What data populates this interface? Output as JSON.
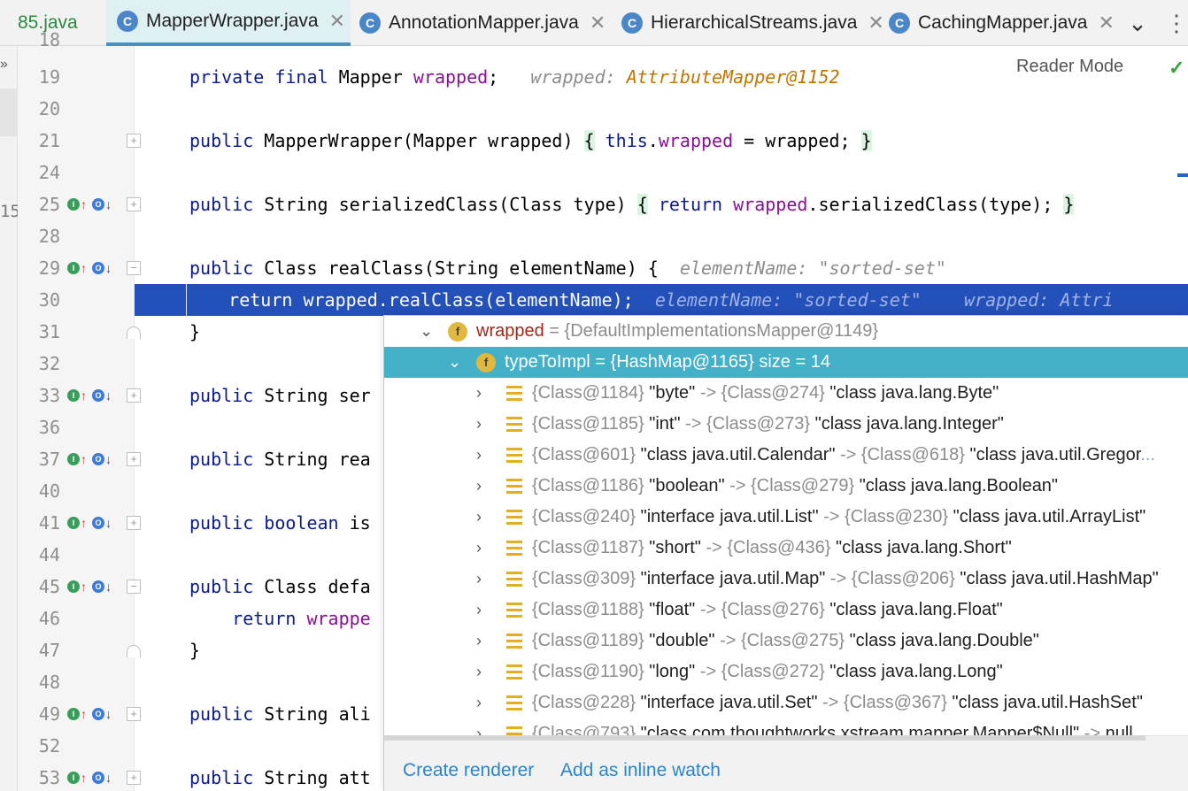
{
  "tabs": [
    {
      "label": "85.java",
      "active": false,
      "icon": "none",
      "close": false
    },
    {
      "label": "MapperWrapper.java",
      "active": true,
      "icon": "java-class-icon",
      "close": true
    },
    {
      "label": "AnnotationMapper.java",
      "active": false,
      "icon": "java-class-icon",
      "close": true
    },
    {
      "label": "HierarchicalStreams.java",
      "active": false,
      "icon": "java-class-icon",
      "close": true
    },
    {
      "label": "CachingMapper.java",
      "active": false,
      "icon": "java-class-icon",
      "close": true
    }
  ],
  "tab_icon_letter": "C",
  "tab_close_glyph": "✕",
  "tab_more_glyph": "⌄",
  "tab_options_glyph": "⋮",
  "left_strip": {
    "expand_glyph": "»",
    "partial_number": "15"
  },
  "reader_mode": "Reader Mode",
  "editor": {
    "partial_top_line": "18",
    "lines": [
      {
        "n": "19",
        "tokens": [
          [
            "kw",
            "private final "
          ],
          [
            "",
            "Mapper "
          ],
          [
            "fld",
            "wrapped"
          ],
          [
            "",
            ";"
          ],
          [
            "",
            "   "
          ],
          [
            "hint",
            "wrapped: "
          ],
          [
            "hval",
            "AttributeMapper@1152"
          ]
        ]
      },
      {
        "n": "20",
        "tokens": []
      },
      {
        "n": "21",
        "fold": "plus",
        "tokens": [
          [
            "kw",
            "public "
          ],
          [
            "",
            "MapperWrapper(Mapper wrapped) "
          ],
          [
            "brace",
            "{"
          ],
          [
            "",
            " "
          ],
          [
            "kw",
            "this"
          ],
          [
            "",
            "."
          ],
          [
            "fld",
            "wrapped"
          ],
          [
            "",
            " = wrapped; "
          ],
          [
            "brace",
            "}"
          ]
        ]
      },
      {
        "n": "24",
        "tokens": []
      },
      {
        "n": "25",
        "icons": true,
        "fold": "plus",
        "tokens": [
          [
            "kw",
            "public "
          ],
          [
            "",
            "String serializedClass(Class type) "
          ],
          [
            "brace",
            "{"
          ],
          [
            "",
            " "
          ],
          [
            "kw",
            "return "
          ],
          [
            "fld",
            "wrapped"
          ],
          [
            "",
            ".serializedClass(type); "
          ],
          [
            "brace",
            "}"
          ]
        ]
      },
      {
        "n": "28",
        "tokens": []
      },
      {
        "n": "29",
        "icons": true,
        "fold": "minus",
        "tokens": [
          [
            "kw",
            "public "
          ],
          [
            "",
            "Class realClass(String elementName) {  "
          ],
          [
            "hint",
            "elementName: \"sorted-set\""
          ]
        ]
      },
      {
        "n": "30",
        "highlight": true,
        "tokens": [
          [
            "",
            "    return wrapped.realClass(elementName);  "
          ],
          [
            "hint",
            "elementName: \"sorted-set\"    wrapped: Attri"
          ]
        ]
      },
      {
        "n": "31",
        "fold": "end",
        "tokens": [
          [
            "",
            "}"
          ]
        ]
      },
      {
        "n": "32",
        "tokens": []
      },
      {
        "n": "33",
        "icons": true,
        "fold": "plus",
        "tokens": [
          [
            "kw",
            "public "
          ],
          [
            "",
            "String ser"
          ]
        ]
      },
      {
        "n": "36",
        "tokens": []
      },
      {
        "n": "37",
        "icons": true,
        "fold": "plus",
        "tokens": [
          [
            "kw",
            "public "
          ],
          [
            "",
            "String rea"
          ]
        ]
      },
      {
        "n": "40",
        "tokens": []
      },
      {
        "n": "41",
        "icons": true,
        "fold": "plus",
        "tokens": [
          [
            "kw",
            "public boolean "
          ],
          [
            "",
            "is"
          ]
        ]
      },
      {
        "n": "44",
        "tokens": []
      },
      {
        "n": "45",
        "icons": true,
        "fold": "minus",
        "tokens": [
          [
            "kw",
            "public "
          ],
          [
            "",
            "Class defa"
          ]
        ]
      },
      {
        "n": "46",
        "tokens": [
          [
            "",
            "    "
          ],
          [
            "kw",
            "return "
          ],
          [
            "fld",
            "wrappe"
          ]
        ]
      },
      {
        "n": "47",
        "fold": "end",
        "tokens": [
          [
            "",
            "}"
          ]
        ]
      },
      {
        "n": "48",
        "tokens": []
      },
      {
        "n": "49",
        "icons": true,
        "fold": "plus",
        "tokens": [
          [
            "kw",
            "public "
          ],
          [
            "",
            "String ali"
          ]
        ]
      },
      {
        "n": "52",
        "tokens": []
      },
      {
        "n": "53",
        "icons": true,
        "fold": "plus",
        "tokens": [
          [
            "kw",
            "public "
          ],
          [
            "",
            "String att"
          ]
        ]
      }
    ]
  },
  "debug_popup": {
    "field_icon_letter": "f",
    "expanded_glyph": "⌄",
    "collapsed_glyph": "›",
    "root": {
      "name": "wrapped",
      "value": " = {DefaultImplementationsMapper@1149}"
    },
    "selected": {
      "name": "typeToImpl",
      "value": " = {HashMap@1165}  size = 14"
    },
    "entries": [
      {
        "key_ref": "{Class@1184}",
        "key": " \"byte\" ",
        "arrow": "->",
        "val_ref": " {Class@274}",
        "val": " \"class java.lang.Byte\""
      },
      {
        "key_ref": "{Class@1185}",
        "key": " \"int\" ",
        "arrow": "->",
        "val_ref": " {Class@273}",
        "val": " \"class java.lang.Integer\""
      },
      {
        "key_ref": "{Class@601}",
        "key": " \"class java.util.Calendar\" ",
        "arrow": "->",
        "val_ref": " {Class@618}",
        "val": " \"class java.util.Gregor",
        "ellipsis": "..."
      },
      {
        "key_ref": "{Class@1186}",
        "key": " \"boolean\" ",
        "arrow": "->",
        "val_ref": " {Class@279}",
        "val": " \"class java.lang.Boolean\""
      },
      {
        "key_ref": "{Class@240}",
        "key": " \"interface java.util.List\" ",
        "arrow": "->",
        "val_ref": " {Class@230}",
        "val": " \"class java.util.ArrayList\""
      },
      {
        "key_ref": "{Class@1187}",
        "key": " \"short\" ",
        "arrow": "->",
        "val_ref": " {Class@436}",
        "val": " \"class java.lang.Short\""
      },
      {
        "key_ref": "{Class@309}",
        "key": " \"interface java.util.Map\" ",
        "arrow": "->",
        "val_ref": " {Class@206}",
        "val": " \"class java.util.HashMap\""
      },
      {
        "key_ref": "{Class@1188}",
        "key": " \"float\" ",
        "arrow": "->",
        "val_ref": " {Class@276}",
        "val": " \"class java.lang.Float\""
      },
      {
        "key_ref": "{Class@1189}",
        "key": " \"double\" ",
        "arrow": "->",
        "val_ref": " {Class@275}",
        "val": " \"class java.lang.Double\""
      },
      {
        "key_ref": "{Class@1190}",
        "key": " \"long\" ",
        "arrow": "->",
        "val_ref": " {Class@272}",
        "val": " \"class java.lang.Long\""
      },
      {
        "key_ref": "{Class@228}",
        "key": " \"interface java.util.Set\" ",
        "arrow": "->",
        "val_ref": " {Class@367}",
        "val": " \"class java.util.HashSet\""
      },
      {
        "key_ref": "{Class@793}",
        "key": " \"class com.thoughtworks.xstream.mapper.Mapper$Null\" ",
        "arrow": "->",
        "val_ref": "",
        "val": " null"
      }
    ],
    "footer": {
      "create_renderer": "Create renderer",
      "add_inline_watch": "Add as inline watch"
    }
  }
}
